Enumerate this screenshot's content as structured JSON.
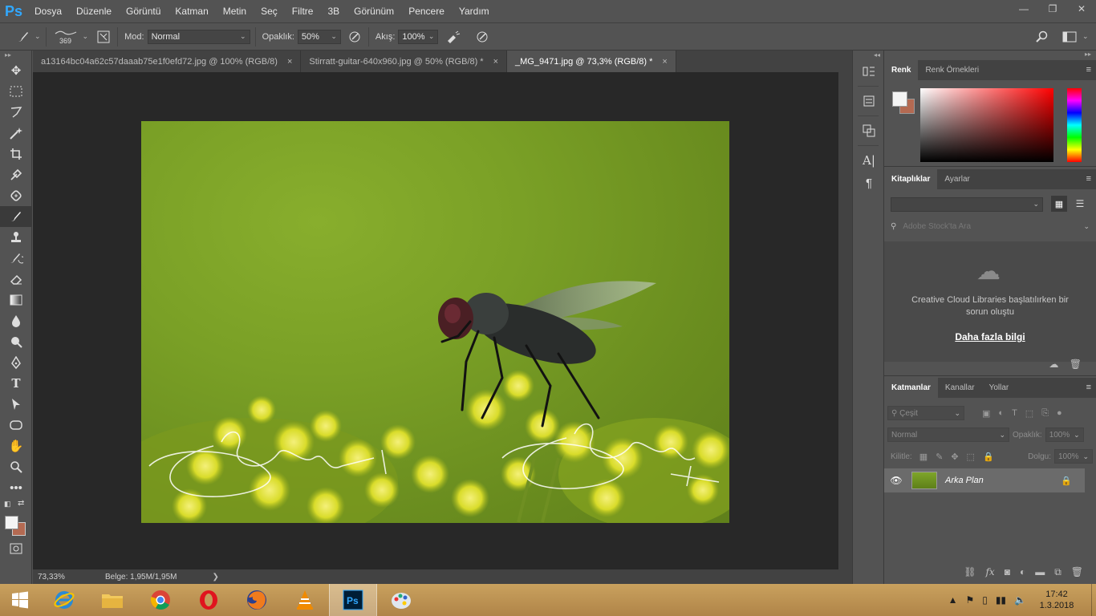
{
  "app": {
    "logo": "Ps"
  },
  "menu": [
    "Dosya",
    "Düzenle",
    "Görüntü",
    "Katman",
    "Metin",
    "Seç",
    "Filtre",
    "3B",
    "Görünüm",
    "Pencere",
    "Yardım"
  ],
  "window_controls": {
    "minimize": "—",
    "restore": "❐",
    "close": "✕"
  },
  "options": {
    "brush_size": "369",
    "mode_label": "Mod:",
    "mode_value": "Normal",
    "opacity_label": "Opaklık:",
    "opacity_value": "50%",
    "flow_label": "Akış:",
    "flow_value": "100%"
  },
  "tabs": [
    {
      "label": "a13164bc04a62c57daaab75e1f0efd72.jpg @ 100% (RGB/8)",
      "close": "×"
    },
    {
      "label": "Stirratt-guitar-640x960.jpg @ 50% (RGB/8) *",
      "close": "×"
    },
    {
      "label": "_MG_9471.jpg @ 73,3% (RGB/8) *",
      "close": "×"
    }
  ],
  "status": {
    "zoom": "73,33%",
    "doc": "Belge: 1,95M/1,95M",
    "arrow": "❯"
  },
  "colors": {
    "foreground": "#f4f4f4",
    "background": "#b46a52",
    "accent": "#31a8ff"
  },
  "color_panel": {
    "tabs": [
      "Renk",
      "Renk Örnekleri"
    ]
  },
  "libraries_panel": {
    "tabs": [
      "Kitaplıklar",
      "Ayarlar"
    ],
    "search_placeholder": "Adobe Stock'ta Ara",
    "message": "Creative Cloud Libraries başlatılırken bir sorun oluştu",
    "link": "Daha fazla bilgi"
  },
  "layers_panel": {
    "tabs": [
      "Katmanlar",
      "Kanallar",
      "Yollar"
    ],
    "filter_label": "Çeşit",
    "blend_mode": "Normal",
    "opacity_label": "Opaklık:",
    "opacity_value": "100%",
    "lock_label": "Kilitle:",
    "fill_label": "Dolgu:",
    "fill_value": "100%",
    "layers": [
      {
        "name": "Arka Plan"
      }
    ]
  },
  "taskbar": {
    "apps": [
      "internet-explorer",
      "file-explorer",
      "chrome",
      "opera",
      "firefox",
      "vlc",
      "photoshop",
      "paint"
    ],
    "time": "17:42",
    "date": "1.3.2018"
  }
}
